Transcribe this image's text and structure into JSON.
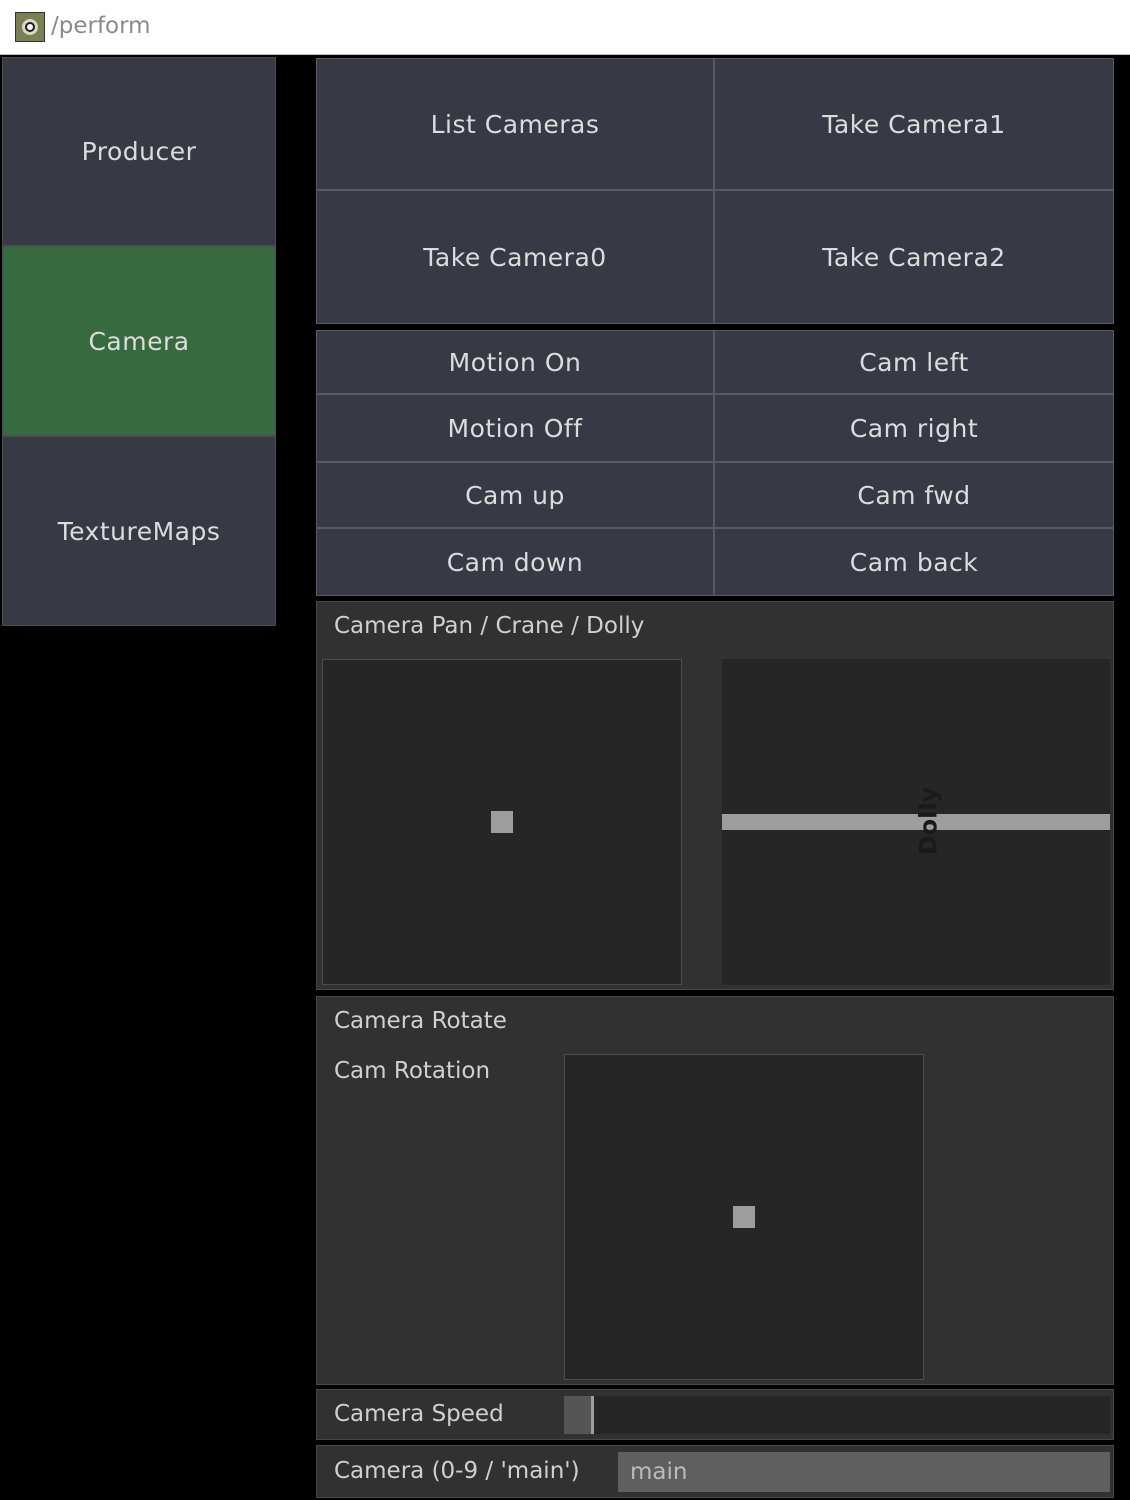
{
  "window": {
    "title": "/perform"
  },
  "tabs": [
    {
      "label": "Producer",
      "active": false
    },
    {
      "label": "Camera",
      "active": true
    },
    {
      "label": "TextureMaps",
      "active": false
    }
  ],
  "camera_buttons": {
    "list_cameras": "List Cameras",
    "take_camera1": "Take Camera1",
    "take_camera0": "Take Camera0",
    "take_camera2": "Take Camera2"
  },
  "motion_buttons": {
    "motion_on": "Motion On",
    "cam_left": "Cam left",
    "motion_off": "Motion Off",
    "cam_right": "Cam right",
    "cam_up": "Cam up",
    "cam_fwd": "Cam fwd",
    "cam_down": "Cam down",
    "cam_back": "Cam back"
  },
  "pan_group": {
    "title": "Camera Pan / Crane / Dolly",
    "dolly_label": "Dolly",
    "xy_value": [
      0.5,
      0.5
    ],
    "dolly_value": 0.5
  },
  "rotate_group": {
    "title": "Camera Rotate",
    "control_label": "Cam Rotation",
    "xy_value": [
      0.5,
      0.5
    ]
  },
  "speed": {
    "label": "Camera Speed",
    "value": 0.05
  },
  "camera_select": {
    "label": "Camera (0-9  /  'main')",
    "value": "main"
  },
  "colors": {
    "active_tab": "#376a3e",
    "button": "#373a44",
    "panel": "#313131",
    "handle": "#9d9d9d"
  }
}
